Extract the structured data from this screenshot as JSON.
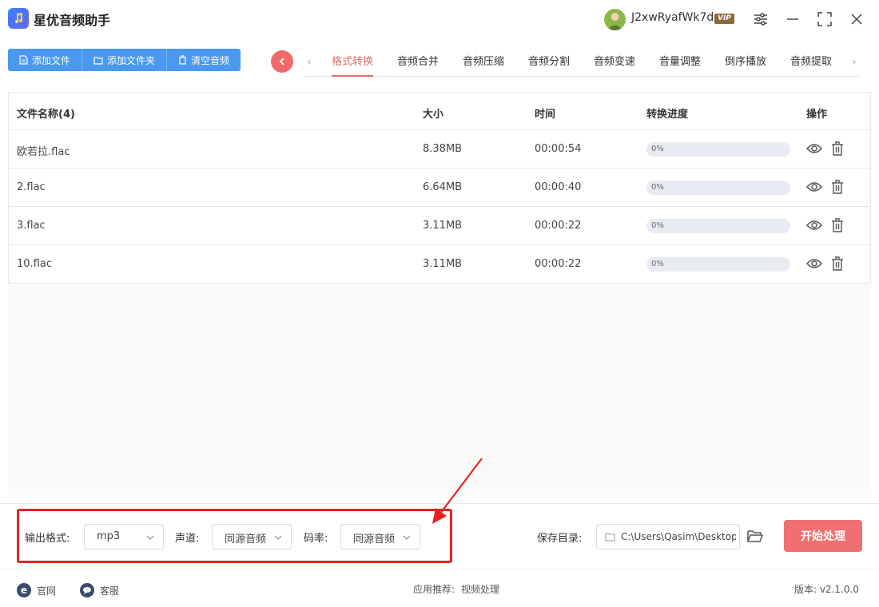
{
  "app": {
    "title": "星优音频助手"
  },
  "user": {
    "name": "J2xwRyafWk7d",
    "badge": "VIP"
  },
  "toolbar": {
    "add_file": "添加文件",
    "add_folder": "添加文件夹",
    "clear_audio": "清空音频"
  },
  "tabs": [
    "格式转换",
    "音频合并",
    "音频压缩",
    "音频分割",
    "音频变速",
    "音量调整",
    "倒序播放",
    "音频提取"
  ],
  "active_tab": "格式转换",
  "table": {
    "headers": {
      "name": "文件名称(4)",
      "size": "大小",
      "time": "时间",
      "progress": "转换进度",
      "ops": "操作"
    },
    "rows": [
      {
        "name": "欧若拉.flac",
        "size": "8.38MB",
        "time": "00:00:54",
        "progress_text": "0%",
        "progress": 0
      },
      {
        "name": "2.flac",
        "size": "6.64MB",
        "time": "00:00:40",
        "progress_text": "0%",
        "progress": 0
      },
      {
        "name": "3.flac",
        "size": "3.11MB",
        "time": "00:00:22",
        "progress_text": "0%",
        "progress": 0
      },
      {
        "name": "10.flac",
        "size": "3.11MB",
        "time": "00:00:22",
        "progress_text": "0%",
        "progress": 0
      }
    ]
  },
  "settings": {
    "format_label": "输出格式:",
    "format_value": "mp3",
    "channel_label": "声道:",
    "channel_value": "同源音频",
    "bitrate_label": "码率:",
    "bitrate_value": "同源音频",
    "save_label": "保存目录:",
    "save_path": "C:\\Users\\Qasim\\Desktop",
    "start_button": "开始处理"
  },
  "footer": {
    "website": "官网",
    "support": "客服",
    "recommend_label": "应用推荐:",
    "recommend_link": "视频处理",
    "version": "版本: v2.1.0.0"
  },
  "colors": {
    "accent_blue": "#4a98ef",
    "accent_red": "#f07070",
    "highlight": "#e82222"
  }
}
